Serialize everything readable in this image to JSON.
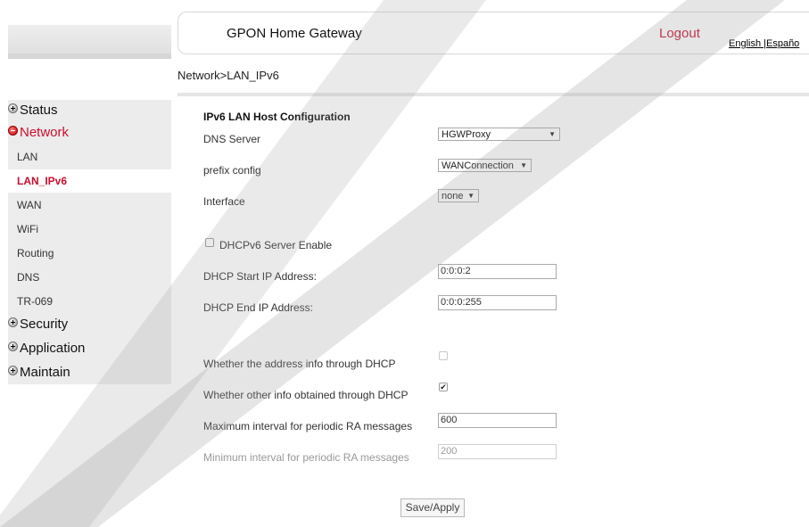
{
  "header": {
    "title": "GPON Home Gateway",
    "logout_label": "Logout",
    "language_links": "English |Españo"
  },
  "breadcrumb": "Network>LAN_IPv6",
  "sidebar": {
    "groups": [
      {
        "label": "Status",
        "expanded": false
      },
      {
        "label": "Network",
        "expanded": true
      },
      {
        "label": "Security",
        "expanded": false
      },
      {
        "label": "Application",
        "expanded": false
      },
      {
        "label": "Maintain",
        "expanded": false
      }
    ],
    "network_items": [
      "LAN",
      "LAN_IPv6",
      "WAN",
      "WiFi",
      "Routing",
      "DNS",
      "TR-069"
    ],
    "selected_item": "LAN_IPv6"
  },
  "form": {
    "section_title": "IPv6 LAN Host Configuration",
    "dns_server": {
      "label": "DNS Server",
      "value": "HGWProxy"
    },
    "prefix_config": {
      "label": "prefix config",
      "value": "WANConnection"
    },
    "interface": {
      "label": "Interface",
      "value": "none"
    },
    "dhcpv6_enable": {
      "label": "DHCPv6 Server Enable",
      "checked": false
    },
    "dhcp_start": {
      "label": "DHCP Start IP Address:",
      "value": "0:0:0:2"
    },
    "dhcp_end": {
      "label": "DHCP End IP Address:",
      "value": "0:0:0:255"
    },
    "addr_info_dhcp": {
      "label": "Whether the address info through DHCP",
      "checked": false
    },
    "other_info_dhcp": {
      "label": "Whether other info obtained through DHCP",
      "checked": true
    },
    "max_ra": {
      "label": "Maximum interval for periodic RA messages",
      "value": "600"
    },
    "min_ra": {
      "label": "Minimum interval for periodic RA messages",
      "value": "200"
    },
    "save_label": "Save/Apply"
  },
  "colors": {
    "accent": "#c8102e",
    "sidebar_bg": "#ececec"
  }
}
